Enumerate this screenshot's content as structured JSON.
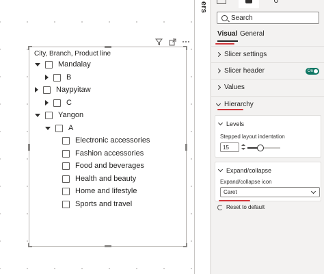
{
  "panel": {
    "collapsed_label": "ers"
  },
  "slicer": {
    "title": "City, Branch, Product line",
    "rows": [
      {
        "label": "Mandalay",
        "level": 0,
        "caret": "down"
      },
      {
        "label": "B",
        "level": 1,
        "caret": "right"
      },
      {
        "label": "Naypyitaw",
        "level": 0,
        "caret": "right"
      },
      {
        "label": "C",
        "level": 1,
        "caret": "right"
      },
      {
        "label": "Yangon",
        "level": 0,
        "caret": "down"
      },
      {
        "label": "A",
        "level": 1,
        "caret": "down"
      },
      {
        "label": "Electronic accessories",
        "level": 2,
        "caret": "none"
      },
      {
        "label": "Fashion accessories",
        "level": 2,
        "caret": "none"
      },
      {
        "label": "Food and beverages",
        "level": 2,
        "caret": "none"
      },
      {
        "label": "Health and beauty",
        "level": 2,
        "caret": "none"
      },
      {
        "label": "Home and lifestyle",
        "level": 2,
        "caret": "none"
      },
      {
        "label": "Sports and travel",
        "level": 2,
        "caret": "none"
      }
    ]
  },
  "format_pane": {
    "search_placeholder": "Search",
    "tabs": [
      {
        "label": "Visual",
        "active": true
      },
      {
        "label": "General",
        "active": false
      }
    ],
    "sections": {
      "slicer_settings": "Slicer settings",
      "slicer_header": "Slicer header",
      "slicer_header_toggle": "On",
      "values": "Values",
      "hierarchy": "Hierarchy"
    },
    "levels": {
      "title": "Levels",
      "indent_label": "Stepped layout indentation",
      "indent_value": "15",
      "slider_fraction": 0.4
    },
    "expand_collapse": {
      "title": "Expand/collapse",
      "icon_label": "Expand/collapse icon",
      "icon_value": "Caret"
    },
    "reset": "Reset to default"
  },
  "colors": {
    "accent_red": "#d13438",
    "toggle_on": "#117865"
  }
}
